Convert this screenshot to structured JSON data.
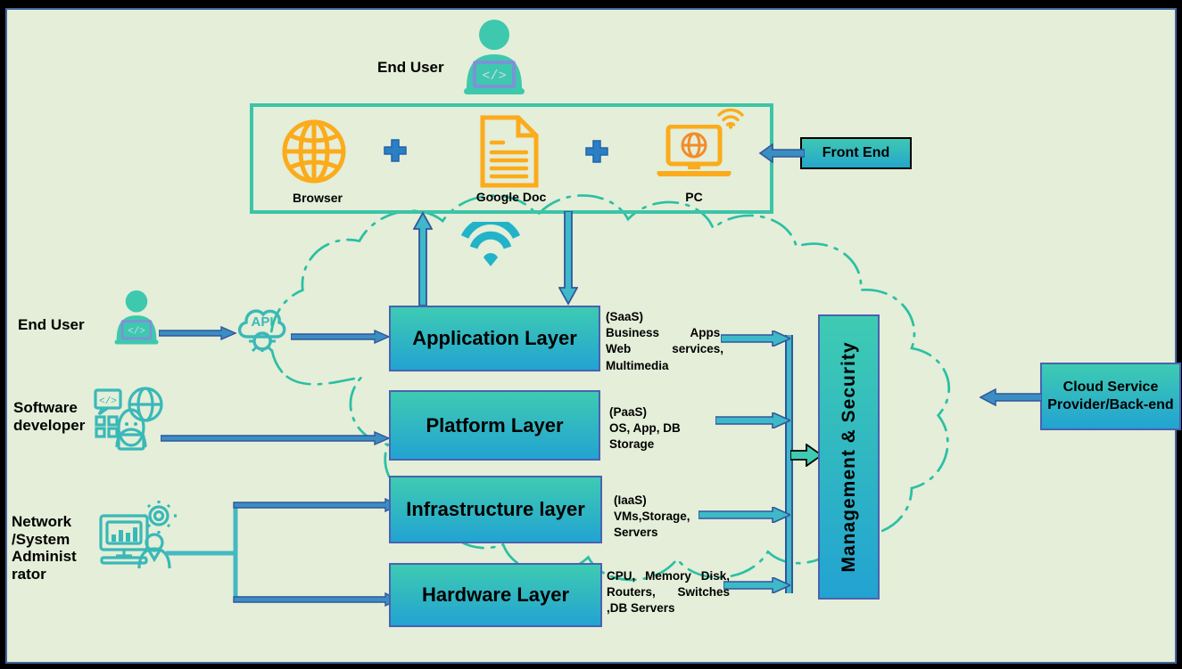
{
  "title": "Cloud Computing Architecture Diagram",
  "background": {
    "page": "#000000",
    "canvas": "#e4eed8",
    "canvas_border": "#41689e"
  },
  "colors": {
    "teal": "#3cc4a8",
    "box_gradient_top": "#3ecbb2",
    "box_gradient_bottom": "#22a3d2",
    "box_border": "#4a62b0",
    "orange": "#f5a623",
    "arrow_blue": "#33559b",
    "arrow_fill": "#3db9c9",
    "cloud_outline": "#2bbfa5"
  },
  "actors": {
    "end_user_top": "End User",
    "end_user_mid": "End User",
    "software_developer": "Software\ndeveloper",
    "network_admin": "Network\n/System\nAdminist\nrator"
  },
  "front_end": {
    "badge_label": "Front End",
    "items": [
      {
        "icon": "globe-icon",
        "label": "Browser"
      },
      {
        "icon": "document-icon",
        "label": "Google Doc"
      },
      {
        "icon": "laptop-globe-icon",
        "label": "PC"
      }
    ],
    "separators": [
      "plus-icon",
      "plus-icon"
    ],
    "wifi_icon": "wifi-icon"
  },
  "layers": [
    {
      "name": "Application Layer",
      "note": "(SaaS)\nBusiness  Apps,  Web services, Multimedia"
    },
    {
      "name": "Platform Layer",
      "note": "(PaaS)\nOS, App, DB Storage"
    },
    {
      "name": "Infrastructure layer",
      "note": "(IaaS)\nVMs,Storage,\nServers"
    },
    {
      "name": "Hardware Layer",
      "note": "CPU,   Memory   Disk, Routers,      Switches ,DB Servers"
    }
  ],
  "layer_notes": {
    "saas_tag": "(SaaS)",
    "saas_body": "Business  Apps,  Web services, Multimedia",
    "paas_tag": "(PaaS)",
    "paas_body": "OS, App, DB Storage",
    "iaas_tag": "(IaaS)",
    "iaas_body": "VMs,Storage,\nServers",
    "hw_body": "CPU,   Memory   Disk, Routers,      Switches ,DB Servers"
  },
  "management": {
    "label": "Management & Security"
  },
  "provider": {
    "label": "Cloud Service Provider/Back-end"
  },
  "icons": {
    "api": "API",
    "user_laptop": "user-laptop-icon",
    "developer": "developer-icon",
    "admin": "admin-monitor-gear-icon"
  }
}
